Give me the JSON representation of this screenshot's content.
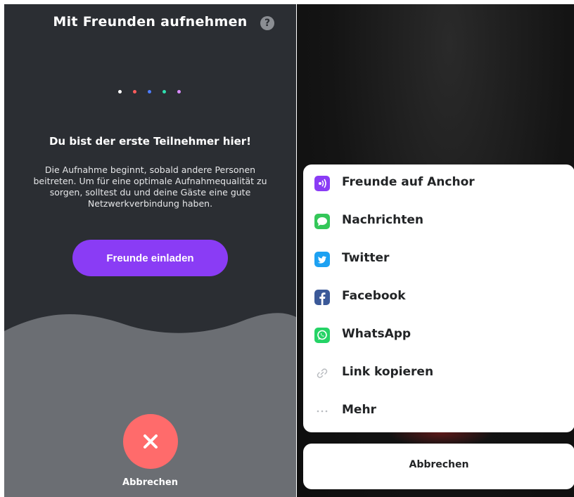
{
  "left_screen": {
    "title": "Mit Freunden aufnehmen",
    "help_glyph": "?",
    "dots": [
      "#ffffff",
      "#ff5c5c",
      "#4d7dff",
      "#2fe0b0",
      "#d98bff"
    ],
    "heading": "Du bist der erste Teilnehmer hier!",
    "body": "Die Aufnahme beginnt, sobald andere Personen beitreten. Um für eine optimale Aufnahmequalität zu sorgen, solltest du und deine Gäste eine gute Netzwerkverbindung haben.",
    "invite_button": "Freunde einladen",
    "cancel_label": "Abbrechen"
  },
  "share_sheet": {
    "items": [
      {
        "label": "Freunde auf Anchor",
        "icon": "anchor-icon"
      },
      {
        "label": "Nachrichten",
        "icon": "messages-icon"
      },
      {
        "label": "Twitter",
        "icon": "twitter-icon"
      },
      {
        "label": "Facebook",
        "icon": "facebook-icon"
      },
      {
        "label": "WhatsApp",
        "icon": "whatsapp-icon"
      },
      {
        "label": "Link kopieren",
        "icon": "link-icon"
      },
      {
        "label": "Mehr",
        "icon": "more-icon"
      }
    ],
    "cancel": "Abbrechen"
  },
  "colors": {
    "accent_purple": "#8a3cf5",
    "cancel_red": "#ff6b6b",
    "dark_bg": "#2b2e33",
    "wave_gray": "#6b6e73"
  }
}
